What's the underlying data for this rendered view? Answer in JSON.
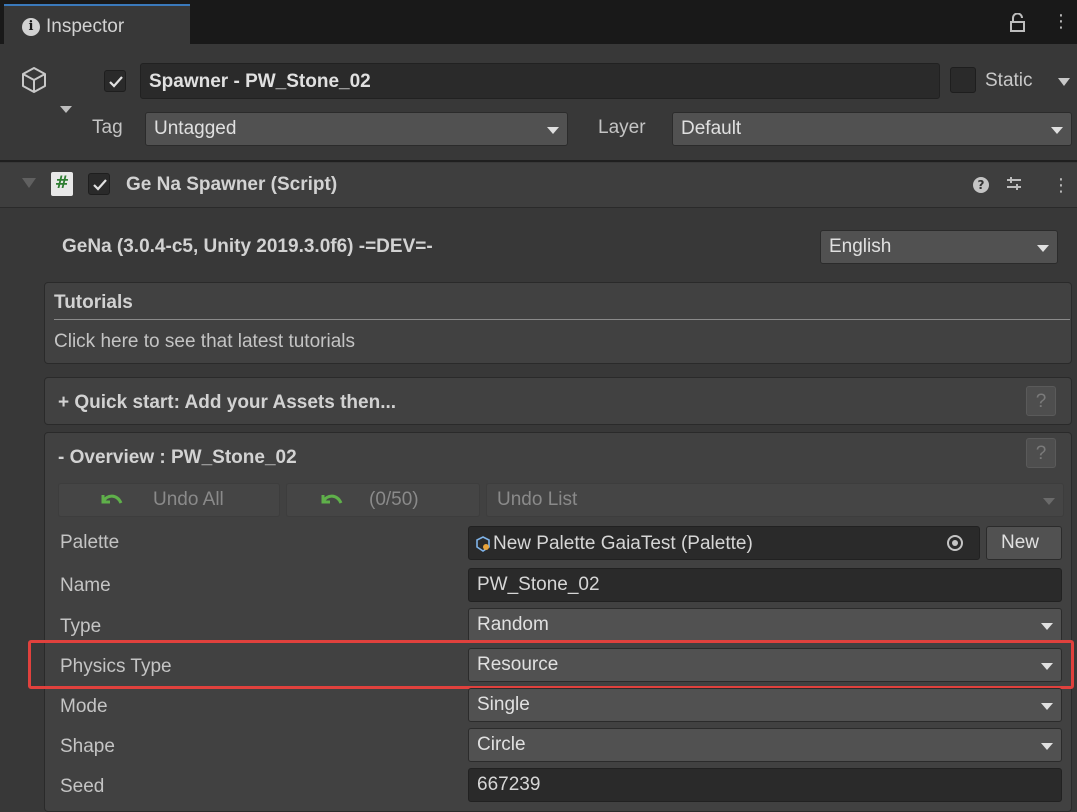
{
  "window": {
    "tab_title": "Inspector"
  },
  "header": {
    "object_name": "Spawner - PW_Stone_02",
    "static_label": "Static",
    "tag_label": "Tag",
    "tag_value": "Untagged",
    "layer_label": "Layer",
    "layer_value": "Default"
  },
  "component": {
    "title": "Ge Na Spawner (Script)",
    "version_text": "GeNa (3.0.4-c5, Unity 2019.3.0f6) -=DEV=-",
    "language": "English"
  },
  "tutorials": {
    "title": "Tutorials",
    "link_text": "Click here to see that latest tutorials"
  },
  "quick_start": {
    "title": "+ Quick start: Add your Assets then...",
    "help": "?"
  },
  "overview": {
    "title": "- Overview : PW_Stone_02",
    "help": "?",
    "undo_all_label": "Undo All",
    "undo_count_label": "(0/50)",
    "undo_list_label": "Undo List",
    "fields": [
      {
        "label": "Palette",
        "value": "New Palette GaiaTest (Palette)"
      },
      {
        "label": "Name",
        "value": "PW_Stone_02"
      },
      {
        "label": "Type",
        "value": "Random"
      },
      {
        "label": "Physics Type",
        "value": "Resource"
      },
      {
        "label": "Mode",
        "value": "Single"
      },
      {
        "label": "Shape",
        "value": "Circle"
      },
      {
        "label": "Seed",
        "value": "667239"
      }
    ],
    "new_button_label": "New"
  },
  "colors": {
    "background": "#383838",
    "tab_strip": "#191919",
    "highlight": "#e0413d",
    "accent": "#3a79bb",
    "undo_green": "#5fb04a"
  },
  "icons": [
    "info-icon",
    "lock-icon",
    "kebab-menu-icon",
    "cube-icon",
    "checkmark-icon",
    "script-icon",
    "help-icon",
    "preset-icon",
    "undo-icon",
    "object-picker-icon",
    "palette-icon"
  ]
}
